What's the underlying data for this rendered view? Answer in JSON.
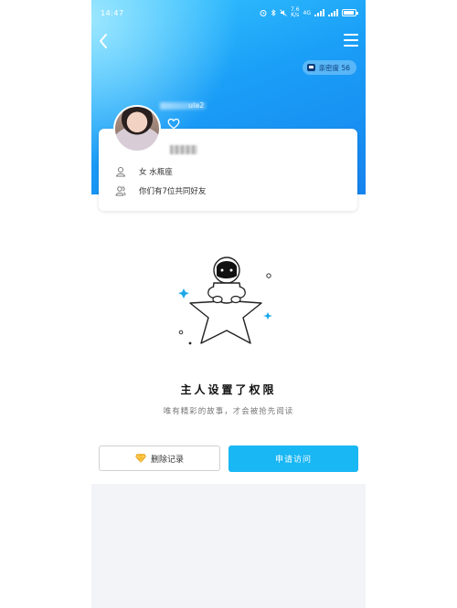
{
  "status_bar": {
    "time": "14:47",
    "net_speed_value": "7.6",
    "net_speed_unit": "K/s",
    "network_label": "4G"
  },
  "nav": {
    "back_icon": "chevron-left-icon",
    "menu_icon": "hamburger-menu-icon"
  },
  "profile": {
    "attention_label": "亲密度 56",
    "nickname_suffix": "ula2",
    "info_rows": [
      {
        "icon": "person-icon",
        "text": "女 水瓶座"
      },
      {
        "icon": "friends-icon",
        "text": "你们有7位共同好友"
      }
    ]
  },
  "empty_state": {
    "title": "主人设置了权限",
    "subtitle": "唯有精彩的故事，才会被抢先阅读"
  },
  "actions": {
    "delete_label": "删除记录",
    "apply_label": "申请访问"
  },
  "colors": {
    "header_blue": "#1a9ff7",
    "apply_button": "#19b7f4",
    "star_accent": "#1ba8ea"
  }
}
